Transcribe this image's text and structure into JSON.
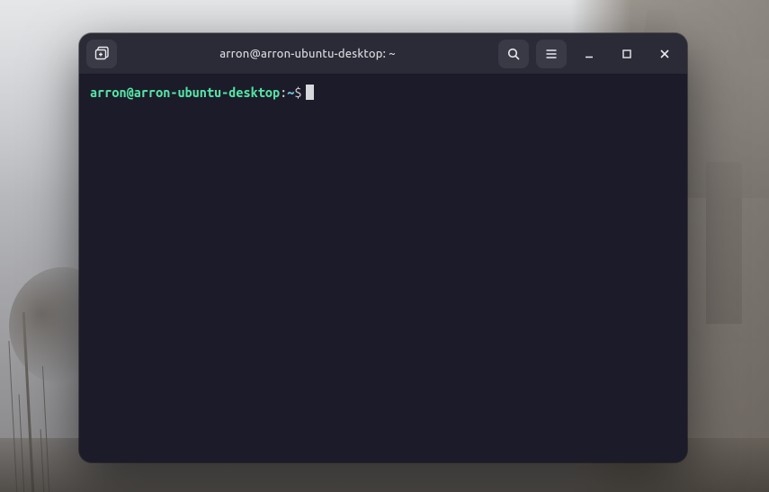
{
  "window": {
    "title": "arron@arron-ubuntu-desktop: ~"
  },
  "prompt": {
    "user_host": "arron@arron-ubuntu-desktop",
    "colon": ":",
    "cwd": "~",
    "symbol": "$"
  },
  "icons": {
    "new_tab": "new-tab-icon",
    "search": "search-icon",
    "menu": "hamburger-menu-icon",
    "minimize": "minimize-icon",
    "maximize": "maximize-icon",
    "close": "close-icon"
  }
}
